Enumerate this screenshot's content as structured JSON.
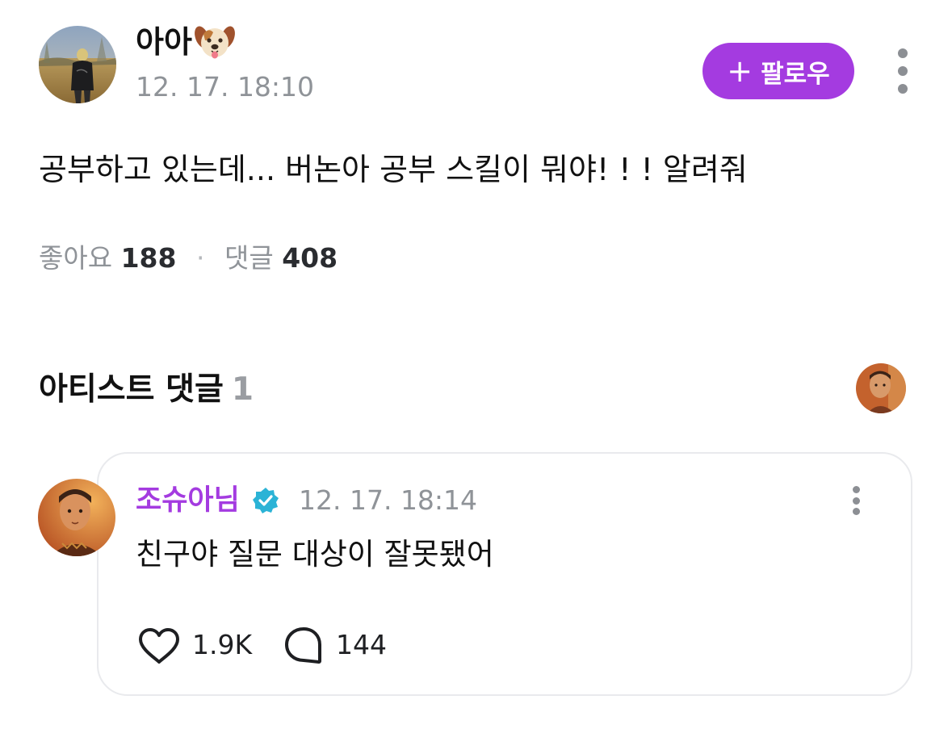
{
  "post": {
    "author": {
      "name": "아아",
      "name_emoji_icon": "dog-face-icon",
      "avatar_icon": "user-avatar-photo"
    },
    "timestamp": "12. 17. 18:10",
    "follow_button": {
      "icon": "plus-icon",
      "label": "팔로우",
      "color": "#a43be0"
    },
    "more_icon": "more-vertical-icon",
    "body": "공부하고 있는데... 버논아 공부 스킬이 뭐야! ! ! 알려줘",
    "stats": {
      "likes_label": "좋아요",
      "likes_count": "188",
      "separator": "·",
      "comments_label": "댓글",
      "comments_count": "408"
    }
  },
  "artist_comments": {
    "title": "아티스트 댓글",
    "count": "1",
    "artist_avatar_icon": "artist-avatar-photo",
    "comments": [
      {
        "author": "조슈아님",
        "verified_icon": "verified-badge-icon",
        "timestamp": "12. 17. 18:14",
        "text": "친구야 질문 대상이 잘못됐어",
        "likes": "1.9K",
        "replies": "144",
        "like_icon": "heart-icon",
        "reply_icon": "comment-bubble-icon",
        "more_icon": "more-vertical-icon",
        "name_color": "#a43be0"
      }
    ]
  }
}
